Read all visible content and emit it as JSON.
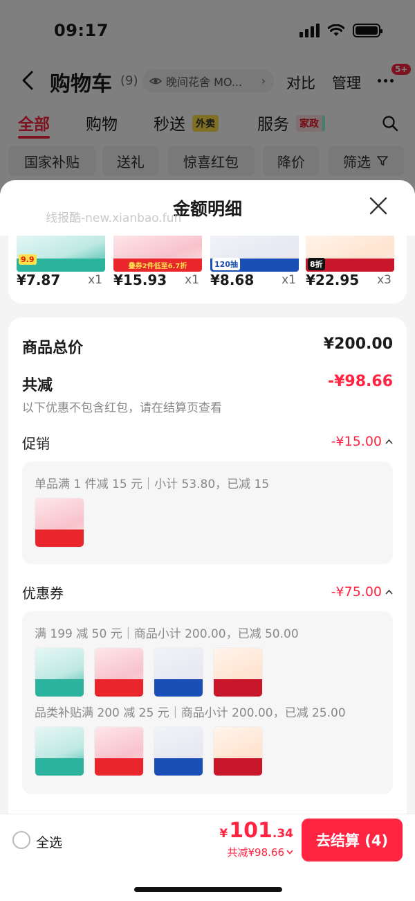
{
  "status_bar": {
    "time": "09:17"
  },
  "header": {
    "title": "购物车",
    "count": "(9)",
    "store": "晚间花舍 MO...",
    "compare": "对比",
    "manage": "管理",
    "badge": "5+"
  },
  "tabs": [
    {
      "label": "全部"
    },
    {
      "label": "购物"
    },
    {
      "label": "秒送",
      "tag": "外卖"
    },
    {
      "label": "服务",
      "tag": "家政"
    }
  ],
  "chips": [
    "国家补贴",
    "送礼",
    "惊喜红包",
    "降价",
    "筛选"
  ],
  "sheet": {
    "title": "金额明细",
    "watermark": "线报酷-new.xianbao.fun",
    "items": [
      {
        "price": "¥7.87",
        "qty": "x1",
        "badge": "9.9"
      },
      {
        "price": "¥15.93",
        "qty": "x1",
        "badge": "叠券2件低至6.7折"
      },
      {
        "price": "¥8.68",
        "qty": "x1",
        "badge": "120抽"
      },
      {
        "price": "¥22.95",
        "qty": "x3",
        "badge": "8折"
      }
    ],
    "total_label": "商品总价",
    "total_value": "¥200.00",
    "discount_label": "共减",
    "discount_value": "-¥98.66",
    "note": "以下优惠不包含红包，请在结算页查看",
    "promo": {
      "label": "促销",
      "value": "-¥15.00",
      "detail": "单品满 1 件减 15 元｜小计 53.80，已减 15"
    },
    "coupon": {
      "label": "优惠券",
      "value": "-¥75.00",
      "detail1": "满 199 减 50 元｜商品小计 200.00，已减 50.00",
      "detail2": "品类补贴满 200 减 25 元｜商品小计 200.00，已减 25.00"
    }
  },
  "bottom_bar": {
    "select_all": "全选",
    "currency": "¥",
    "price_int": "101",
    "price_dec": ".34",
    "discount": "共减¥98.66",
    "checkout": "去结算 (4)"
  },
  "colors": {
    "accent": "#ff2442",
    "overlay": "rgba(0,0,0,0.5)"
  }
}
